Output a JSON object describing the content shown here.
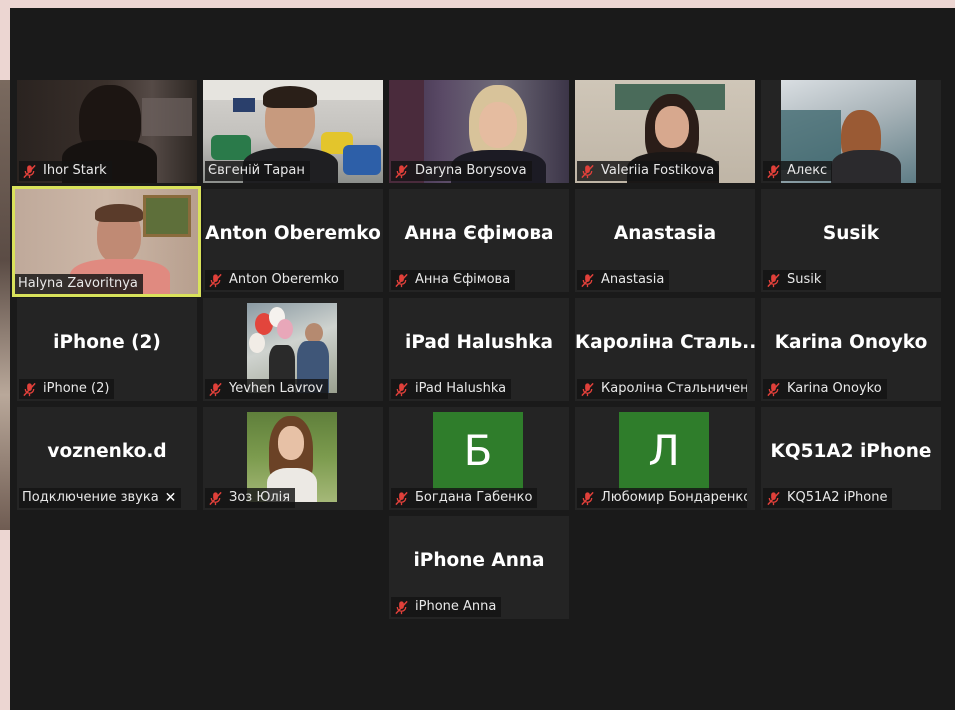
{
  "participants": [
    {
      "label": "Ihor Stark",
      "muted": true
    },
    {
      "label": "Євгеній Таран",
      "muted": false
    },
    {
      "label": "Daryna Borysova",
      "muted": true
    },
    {
      "label": "Valeriia Fostikova",
      "muted": true
    },
    {
      "label": "Алекс",
      "muted": true
    },
    {
      "label": "Halyna Zavoritnya",
      "muted": false,
      "active_speaker": true
    },
    {
      "display": "Anton Oberemko",
      "label": "Anton Oberemko",
      "muted": true
    },
    {
      "display": "Анна Єфімова",
      "label": "Анна Єфімова",
      "muted": true
    },
    {
      "display": "Anastasia",
      "label": "Anastasia",
      "muted": true
    },
    {
      "display": "Susik",
      "label": "Susik",
      "muted": true
    },
    {
      "display": "iPhone (2)",
      "label": "iPhone (2)",
      "muted": true
    },
    {
      "label": "Yevhen Lavrov",
      "muted": true
    },
    {
      "display": "iPad Halushka",
      "label": "iPad Halushka",
      "muted": true
    },
    {
      "display": "Кароліна Сталь...",
      "label": "Кароліна Стальничен...",
      "muted": true
    },
    {
      "display": "Karina Onoyko",
      "label": "Karina Onoyko",
      "muted": true
    },
    {
      "display": "voznenko.d",
      "label": "Подключение звука",
      "muted": false,
      "status_icon": "close-icon"
    },
    {
      "label": "Зоз Юлія",
      "muted": true
    },
    {
      "avatar_letter": "Б",
      "label": "Богдана Габенко",
      "muted": true
    },
    {
      "avatar_letter": "Л",
      "label": "Любомир Бондаренко",
      "muted": true
    },
    {
      "display": "KQ51A2 iPhone",
      "label": "KQ51A2 iPhone",
      "muted": true
    },
    {
      "display": "iPhone Anna",
      "label": "iPhone Anna",
      "muted": true
    }
  ],
  "colors": {
    "background": "#1a1a1a",
    "tile": "#242424",
    "active_border": "#d9e25b",
    "muted_icon": "#e0403a",
    "avatar_green": "#2f7d2b"
  },
  "icons": {
    "muted": "mic-muted-icon",
    "close": "close-icon"
  }
}
